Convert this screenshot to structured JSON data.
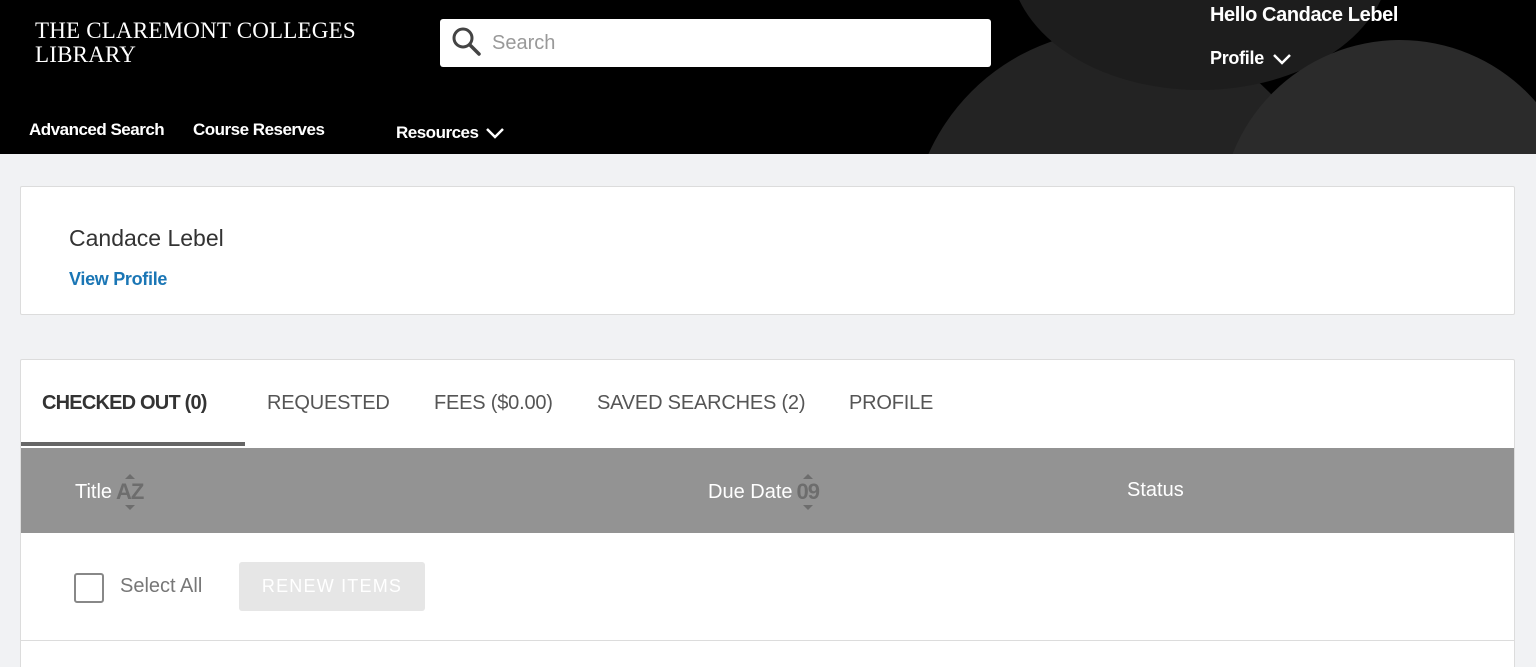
{
  "header": {
    "logo_line1": "THE CLAREMONT COLLEGES",
    "logo_line2": "LIBRARY",
    "search_placeholder": "Search",
    "greeting": "Hello Candace Lebel",
    "profile_menu": "Profile",
    "nav": {
      "advanced_search": "Advanced Search",
      "course_reserves": "Course Reserves",
      "resources": "Resources"
    }
  },
  "profile_card": {
    "name": "Candace Lebel",
    "view_profile": "View Profile"
  },
  "tabs": [
    {
      "label": "CHECKED OUT (0)",
      "active": true
    },
    {
      "label": "REQUESTED",
      "active": false
    },
    {
      "label": "FEES ($0.00)",
      "active": false
    },
    {
      "label": "SAVED SEARCHES (2)",
      "active": false
    },
    {
      "label": "PROFILE",
      "active": false
    }
  ],
  "table": {
    "columns": [
      {
        "label": "Title",
        "sort_glyph": "AZ"
      },
      {
        "label": "Due Date",
        "sort_glyph": "09"
      },
      {
        "label": "Status",
        "sort_glyph": ""
      }
    ]
  },
  "actions": {
    "select_all": "Select All",
    "renew_items": "RENEW ITEMS"
  },
  "colors": {
    "header_bg": "#000000",
    "link_blue": "#1a76b5",
    "table_head_bg": "#939393",
    "page_bg": "#f1f2f4"
  }
}
